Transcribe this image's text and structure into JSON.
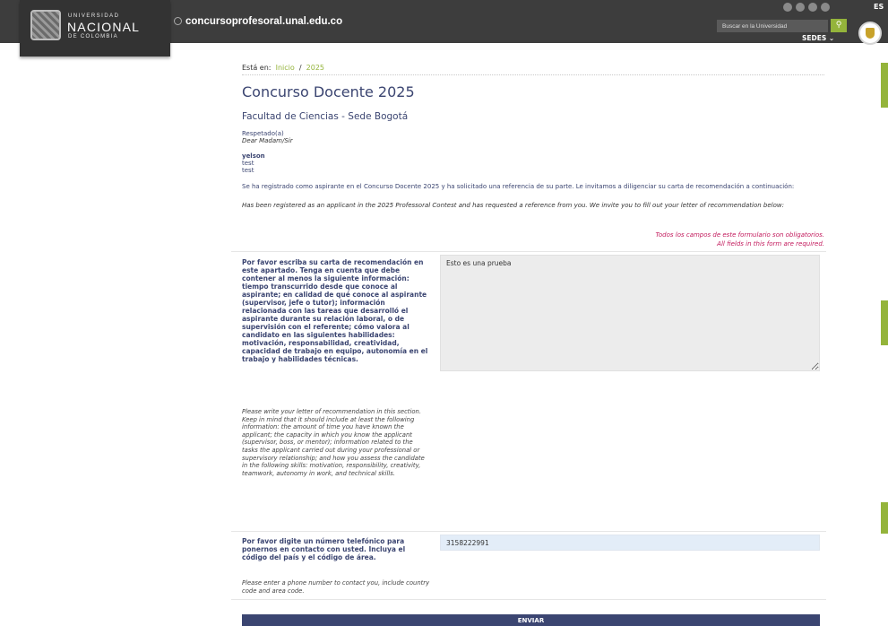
{
  "header": {
    "university_line1": "UNIVERSIDAD",
    "university_line2": "NACIONAL",
    "university_line3": "DE COLOMBIA",
    "site_url": "concursoprofesoral.unal.edu.co",
    "language": "ES",
    "search_placeholder": "Buscar en la Universidad",
    "search_icon_glyph": "⚲",
    "sedes_label": "SEDES",
    "sedes_chevron": "⌄",
    "accent_color": "#94b43b"
  },
  "breadcrumb": {
    "prefix": "Está en:",
    "home": "Inicio",
    "separator": "/",
    "current": "2025"
  },
  "page": {
    "title": "Concurso Docente 2025",
    "subtitle": "Facultad de Ciencias - Sede Bogotá",
    "greeting_es": "Respetado(a)",
    "greeting_en": "Dear Madam/Sir",
    "applicant_name": "yelson",
    "applicant_line2": "test",
    "applicant_line3": "test",
    "intro_es": "Se ha registrado como aspirante en el Concurso Docente 2025 y ha solicitado una referencia de su parte. Le invitamos a diligenciar su carta de recomendación a continuación:",
    "intro_en": "Has been registered as an applicant in the 2025 Professoral Contest and has requested a reference from you. We invite you to fill out your letter of recommendation below:",
    "required_es": "Todos los campos de este formulario son obligatorios.",
    "required_en": "All fields in this form are required."
  },
  "form": {
    "letter_label_es": "Por favor escriba su carta de recomendación en este apartado. Tenga en cuenta que debe contener al menos la siguiente información: tiempo transcurrido desde que conoce al aspirante; en calidad de qué conoce al aspirante (supervisor, jefe o tutor); información relacionada con las tareas que desarrolló el aspirante durante su relación laboral, o de supervisión con el referente; cómo valora al candidato en las siguientes habilidades: motivación, responsabilidad, creatividad, capacidad de trabajo en equipo, autonomía en el trabajo y habilidades técnicas.",
    "letter_label_en": "Please write your letter of recommendation in this section. Keep in mind that it should include at least the following information: the amount of time you have known the applicant; the capacity in which you know the applicant (supervisor, boss, or mentor); information related to the tasks the applicant carried out during your professional or supervisory relationship; and how you assess the candidate in the following skills: motivation, responsibility, creativity, teamwork, autonomy in work, and technical skills.",
    "letter_value": "Esto es una prueba",
    "phone_label_es": "Por favor digite un número telefónico para ponernos en contacto con usted. Incluya el código del país y el código de área.",
    "phone_label_en": "Please enter a phone number to contact you, include country code and area code.",
    "phone_value": "3158222991",
    "submit_label": "ENVIAR"
  }
}
